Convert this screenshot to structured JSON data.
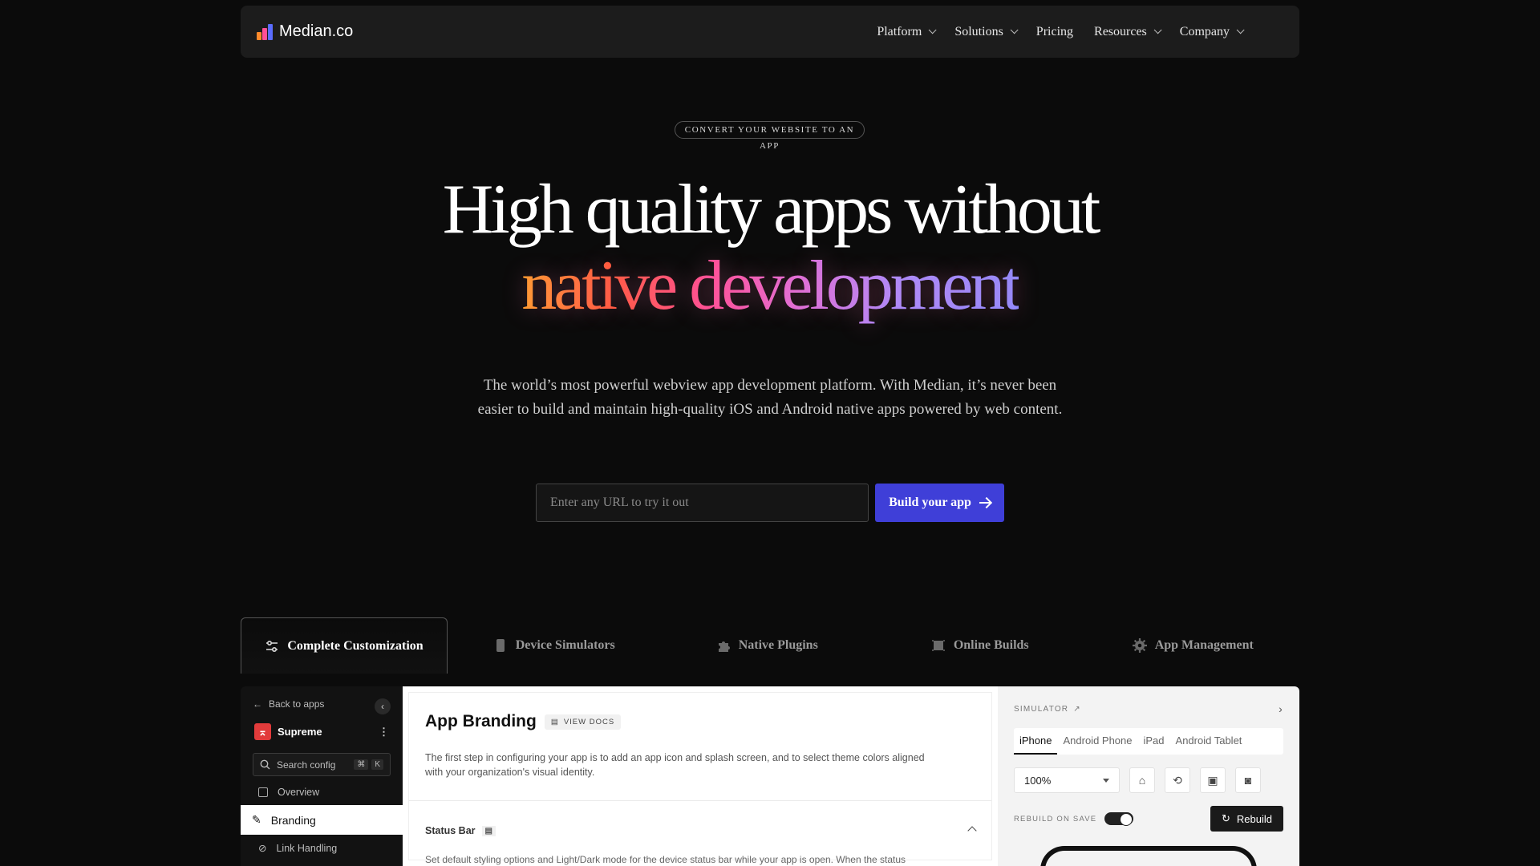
{
  "nav": {
    "brand": "Median.co",
    "items": [
      {
        "label": "Platform",
        "dropdown": true
      },
      {
        "label": "Solutions",
        "dropdown": true
      },
      {
        "label": "Pricing",
        "dropdown": false
      },
      {
        "label": "Resources",
        "dropdown": true
      },
      {
        "label": "Company",
        "dropdown": true
      }
    ]
  },
  "hero": {
    "badge": "Convert your website to an app",
    "title_line1": "High quality apps without",
    "title_line2": "native development",
    "subtitle": "The world’s most powerful webview app development platform. With Median, it’s never been easier to build and maintain high-quality iOS and Android native apps powered by web content.",
    "url_placeholder": "Enter any URL to try it out",
    "cta_label": "Build your app"
  },
  "tabs": [
    {
      "label": "Complete Customization",
      "icon": "sliders-icon",
      "active": true
    },
    {
      "label": "Device Simulators",
      "icon": "phone-icon",
      "active": false
    },
    {
      "label": "Native Plugins",
      "icon": "puzzle-icon",
      "active": false
    },
    {
      "label": "Online Builds",
      "icon": "build-icon",
      "active": false
    },
    {
      "label": "App Management",
      "icon": "gear-icon",
      "active": false
    }
  ],
  "app": {
    "back_label": "Back to apps",
    "app_name": "Supreme",
    "search_placeholder": "Search config",
    "search_keys": [
      "⌘",
      "K"
    ],
    "sidebar": [
      {
        "label": "Overview",
        "icon": "square-icon",
        "active": false
      },
      {
        "label": "Branding",
        "icon": "brush-icon",
        "active": true
      },
      {
        "label": "Link Handling",
        "icon": "link-icon",
        "active": false
      }
    ],
    "main": {
      "title": "App Branding",
      "docs_label": "VIEW DOCS",
      "description": "The first step in configuring your app is to add an app icon and splash screen, and to select theme colors aligned with your organization's visual identity.",
      "section_title": "Status Bar",
      "section_desc": "Set default styling options and Light/Dark mode for the device status bar while your app is open. When the status"
    },
    "simulator": {
      "label": "SIMULATOR",
      "devices": [
        "iPhone",
        "Android Phone",
        "iPad",
        "Android Tablet"
      ],
      "active_device": "iPhone",
      "zoom": "100%",
      "rebuild_on_save_label": "REBUILD ON SAVE",
      "rebuild_on_save": true,
      "rebuild_label": "Rebuild"
    }
  },
  "colors": {
    "accent": "#3f3fd8",
    "background": "#0b0b0b",
    "nav_bg": "#1c1c1c"
  }
}
